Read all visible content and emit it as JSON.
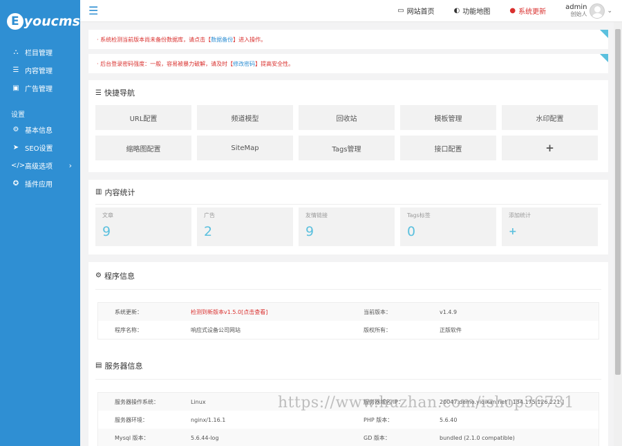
{
  "brand": {
    "logo_letter": "E",
    "logo_text": "youcms"
  },
  "sidebar": {
    "items_main": [
      {
        "label": "栏目管理",
        "icon": "sitemap-icon"
      },
      {
        "label": "内容管理",
        "icon": "list-icon"
      },
      {
        "label": "广告管理",
        "icon": "image-icon"
      }
    ],
    "group_label": "设置",
    "items_settings": [
      {
        "label": "基本信息",
        "icon": "gear-icon"
      },
      {
        "label": "SEO设置",
        "icon": "paper-plane-icon"
      },
      {
        "label": "高级选项",
        "icon": "code-icon"
      },
      {
        "label": "插件应用",
        "icon": "plugin-icon"
      }
    ]
  },
  "topbar": {
    "home": "网站首页",
    "map": "功能地图",
    "update": "系统更新",
    "user_name": "admin",
    "user_role": "创始人"
  },
  "alerts": [
    {
      "text": "· 系统检测当前版本尚未备份数据库，请点击【",
      "link": "数据备份",
      "tail": "】进入操作。"
    },
    {
      "text": "· 后台登录密码强度：一般，容易被暴力破解，请及时【",
      "link": "修改密码",
      "tail": "】提高安全性。"
    }
  ],
  "quick_nav": {
    "title": "快捷导航",
    "buttons": [
      "URL配置",
      "频道模型",
      "回收站",
      "模板管理",
      "水印配置",
      "缩略图配置",
      "SiteMap",
      "Tags管理",
      "接口配置",
      "+"
    ]
  },
  "stats": {
    "title": "内容统计",
    "items": [
      {
        "label": "文章",
        "value": "9"
      },
      {
        "label": "广告",
        "value": "2"
      },
      {
        "label": "友情链接",
        "value": "9"
      },
      {
        "label": "Tags标签",
        "value": "0"
      },
      {
        "label": "添加统计",
        "value": "+"
      }
    ]
  },
  "program_info": {
    "title": "程序信息",
    "rows": [
      [
        "系统更新：",
        "检测到新版本v1.5.0[点击查看]",
        "当前版本：",
        "v1.4.9"
      ],
      [
        "程序名称：",
        "响应式设备公司网站",
        "版权所有：",
        "正版软件"
      ]
    ]
  },
  "server_info": {
    "title": "服务器信息",
    "rows": [
      [
        "服务器操作系统：",
        "Linux",
        "服务器域名/IP：",
        "20047.demo.yiqikan.net [ 134.175.126.221 ]"
      ],
      [
        "服务器环境：",
        "nginx/1.16.1",
        "PHP 版本：",
        "5.6.40"
      ],
      [
        "Mysql 版本：",
        "5.6.44-log",
        "GD 版本：",
        "bundled (2.1.0 compatible)"
      ]
    ]
  },
  "watermark": "https://www.huzhan.com/ishop36731",
  "colors": {
    "sidebar": "#2f8fd3",
    "accent": "#5bc0de",
    "alert": "#d9302e"
  }
}
